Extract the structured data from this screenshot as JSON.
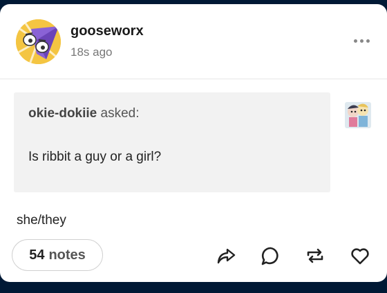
{
  "post": {
    "author": "gooseworx",
    "time": "18s ago",
    "ask": {
      "asker": "okie-dokiie",
      "asked_word": "asked:",
      "question": "Is ribbit a guy or a girl?"
    },
    "answer": "she/they",
    "notes": {
      "count": "54",
      "word": "notes"
    }
  },
  "icons": {
    "more": "more-options-icon",
    "share": "share-icon",
    "reply": "reply-icon",
    "reblog": "reblog-icon",
    "like": "heart-icon"
  },
  "colors": {
    "background": "#001935",
    "card": "#ffffff",
    "ask_box": "#f2f2f2"
  }
}
